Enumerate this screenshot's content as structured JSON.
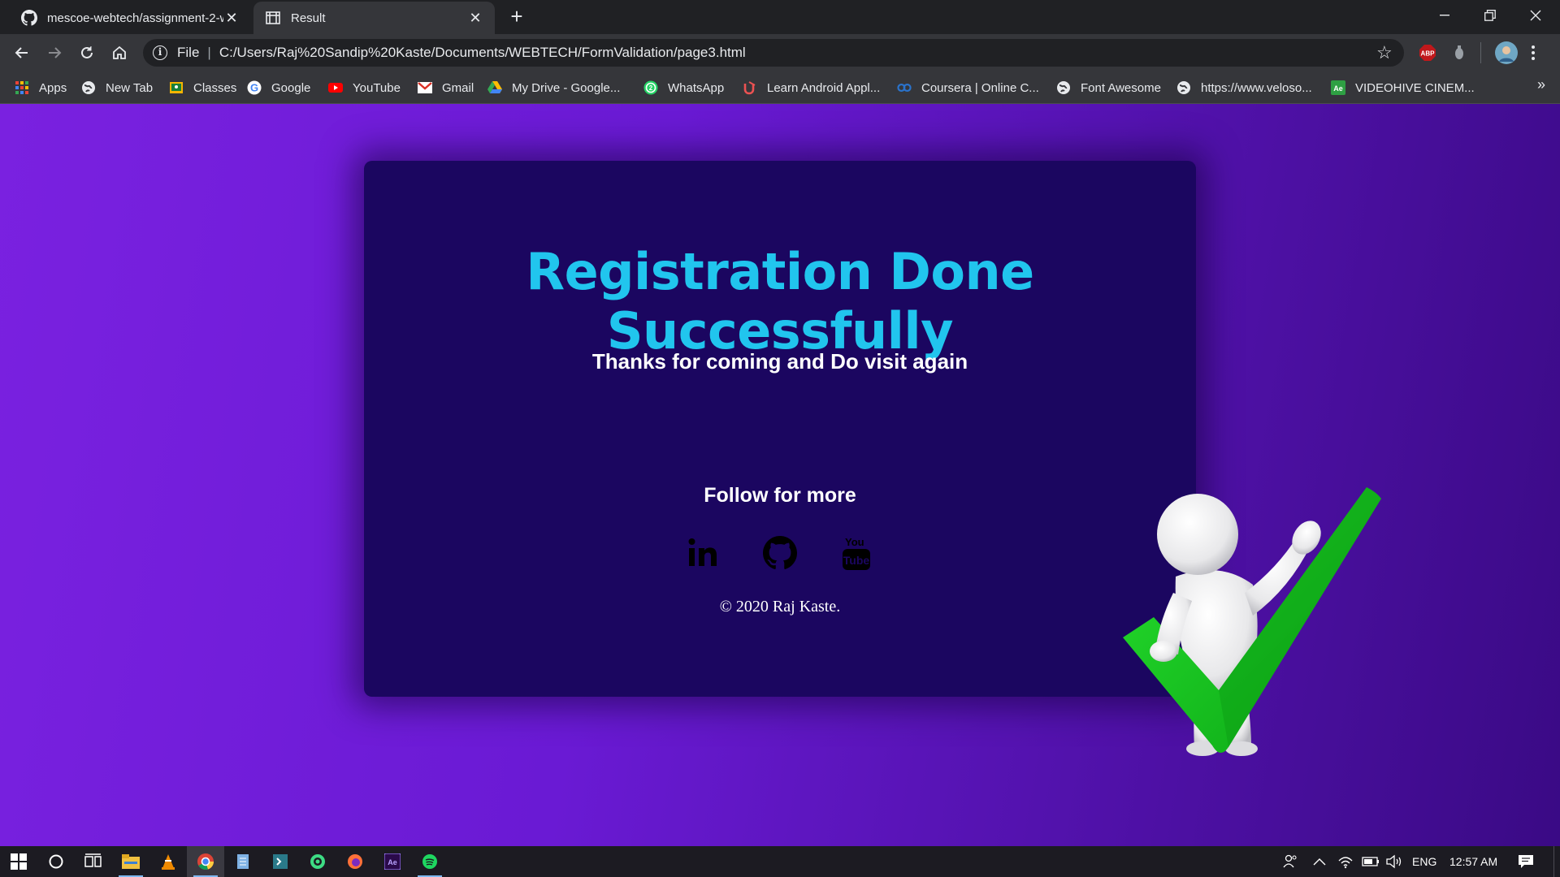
{
  "browser": {
    "tabs": [
      {
        "title": "mescoe-webtech/assignment-2-w",
        "favicon": "github-icon"
      },
      {
        "title": "Result",
        "favicon": "codepen-icon"
      }
    ],
    "address": {
      "scheme": "File",
      "url": "C:/Users/Raj%20Sandip%20Kaste/Documents/WEBTECH/FormValidation/page3.html"
    },
    "extensions": [
      {
        "label": "ABP",
        "color": "#c0181b"
      }
    ],
    "bookmarks": [
      {
        "label": "Apps",
        "icon": "apps-grid-icon"
      },
      {
        "label": "New Tab",
        "icon": "globe-icon"
      },
      {
        "label": "Classes",
        "icon": "classroom-icon"
      },
      {
        "label": "Google",
        "icon": "google-icon"
      },
      {
        "label": "YouTube",
        "icon": "youtube-icon"
      },
      {
        "label": "Gmail",
        "icon": "gmail-icon"
      },
      {
        "label": "My Drive - Google...",
        "icon": "drive-icon"
      },
      {
        "label": "WhatsApp",
        "icon": "whatsapp-icon"
      },
      {
        "label": "Learn Android Appl...",
        "icon": "udemy-icon"
      },
      {
        "label": "Coursera | Online C...",
        "icon": "coursera-icon"
      },
      {
        "label": "Font Awesome",
        "icon": "globe-icon"
      },
      {
        "label": "https://www.veloso...",
        "icon": "globe-icon"
      },
      {
        "label": "VIDEOHIVE CINEM...",
        "icon": "after-effects-icon"
      }
    ],
    "bookmarks_overflow": "»"
  },
  "page": {
    "headline": "Registration Done Successfully",
    "subline": "Thanks for coming and Do visit again",
    "follow": "Follow for more",
    "socials": [
      {
        "name": "linkedin-icon"
      },
      {
        "name": "github-icon"
      },
      {
        "name": "youtube-icon"
      }
    ],
    "copyright": "© 2020 Raj Kaste.",
    "colors": {
      "headline": "#21c5ee",
      "card": "#1b0660",
      "background_start": "#7a21e0",
      "background_end": "#3a0a85",
      "check": "#12c21a"
    }
  },
  "taskbar": {
    "language": "ENG",
    "time": "12:57 AM"
  }
}
